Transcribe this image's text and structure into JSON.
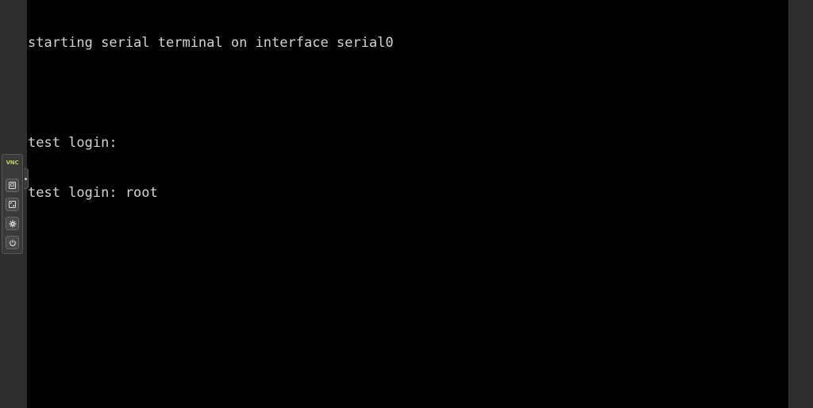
{
  "terminal": {
    "lines": [
      "starting serial terminal on interface serial0",
      "",
      "test login:",
      "test login: root"
    ]
  },
  "control_bar": {
    "logo_text": "VNC",
    "logo_color": "#b6d74e",
    "buttons": [
      {
        "icon": "keyboard-icon"
      },
      {
        "icon": "fullscreen-icon"
      },
      {
        "icon": "gear-icon"
      },
      {
        "icon": "power-icon"
      }
    ]
  }
}
